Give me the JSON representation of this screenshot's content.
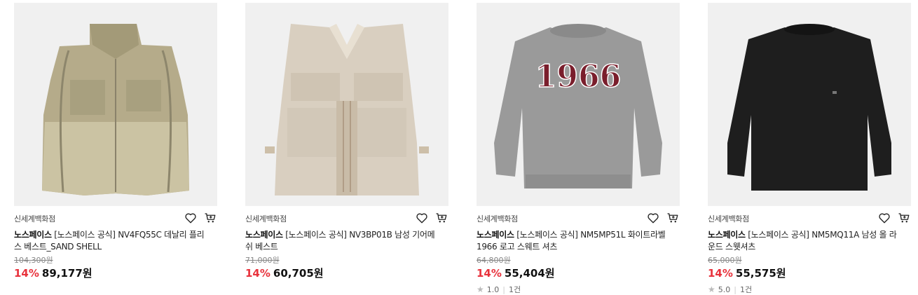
{
  "products": [
    {
      "store": "신세계백화점",
      "brand": "노스페이스",
      "name": "[노스페이스 공식] NV4FQ55C 데날리 플리스 베스트_SAND SHELL",
      "original_price": "104,300원",
      "discount": "14%",
      "price": "89,177원"
    },
    {
      "store": "신세계백화점",
      "brand": "노스페이스",
      "name": "[노스페이스 공식] NV3BP01B 남성 기어메쉬 베스트",
      "original_price": "71,000원",
      "discount": "14%",
      "price": "60,705원"
    },
    {
      "store": "신세계백화점",
      "brand": "노스페이스",
      "name": "[노스페이스 공식] NM5MP51L 화이트라벨 1966 로고 스웨트 셔츠",
      "original_price": "64,800원",
      "discount": "14%",
      "price": "55,404원",
      "rating": "1.0",
      "reviews": "1건",
      "graphic_text": "1966"
    },
    {
      "store": "신세계백화점",
      "brand": "노스페이스",
      "name": "[노스페이스 공식] NM5MQ11A 남성 올 라운드 스웻셔츠",
      "original_price": "65,000원",
      "discount": "14%",
      "price": "55,575원",
      "rating": "5.0",
      "reviews": "1건"
    }
  ],
  "colors": {
    "discount": "#e8323c",
    "image_bg": "#f0f0f0"
  },
  "icons": [
    "heart-icon",
    "cart-icon",
    "star-icon"
  ]
}
